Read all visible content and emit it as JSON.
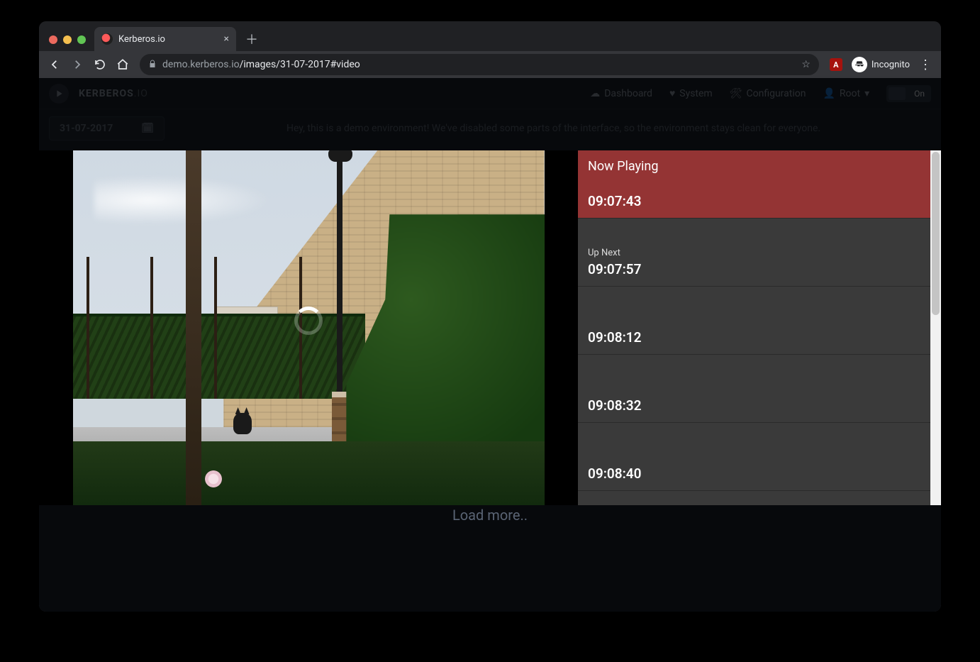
{
  "browser": {
    "tab_title": "Kerberos.io",
    "url_host": "demo.kerberos.io",
    "url_path": "/images/31-07-2017#video",
    "incognito_label": "Incognito"
  },
  "app": {
    "brand_primary": "KERBEROS",
    "brand_secondary": ".IO",
    "nav": {
      "dashboard": "Dashboard",
      "system": "System",
      "configuration": "Configuration",
      "user": "Root",
      "toggle": "On"
    },
    "date": "31-07-2017",
    "notice": "Hey, this is a demo environment! We've disabled some parts of the interface, so the environment stays clean for everyone.",
    "load_more": "Load more.."
  },
  "overlay": {
    "now_playing_label": "Now Playing",
    "up_next_label": "Up Next",
    "items": [
      {
        "time": "09:07:43",
        "state": "now"
      },
      {
        "time": "09:07:57",
        "state": "upnext"
      },
      {
        "time": "09:08:12",
        "state": "queued"
      },
      {
        "time": "09:08:32",
        "state": "queued"
      },
      {
        "time": "09:08:40",
        "state": "queued"
      }
    ]
  }
}
